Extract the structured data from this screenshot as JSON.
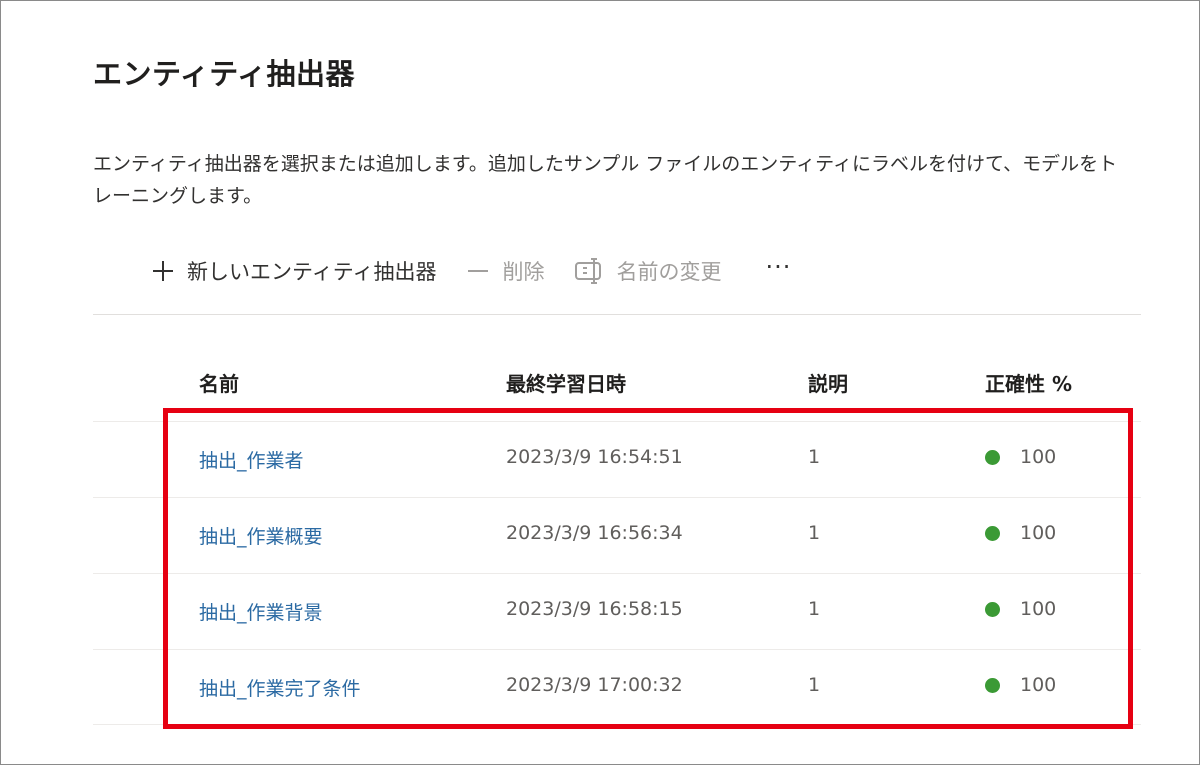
{
  "page": {
    "title": "エンティティ抽出器",
    "description": "エンティティ抽出器を選択または追加します。追加したサンプル ファイルのエンティティにラベルを付けて、モデルをトレーニングします。"
  },
  "toolbar": {
    "new_label": "新しいエンティティ抽出器",
    "delete_label": "削除",
    "rename_label": "名前の変更",
    "more_label": "···"
  },
  "table": {
    "columns": [
      "名前",
      "最終学習日時",
      "説明",
      "正確性 %"
    ],
    "rows": [
      {
        "name": "抽出_作業者",
        "date": "2023/3/9 16:54:51",
        "desc": "1",
        "accuracy": "100"
      },
      {
        "name": "抽出_作業概要",
        "date": "2023/3/9 16:56:34",
        "desc": "1",
        "accuracy": "100"
      },
      {
        "name": "抽出_作業背景",
        "date": "2023/3/9 16:58:15",
        "desc": "1",
        "accuracy": "100"
      },
      {
        "name": "抽出_作業完了条件",
        "date": "2023/3/9 17:00:32",
        "desc": "1",
        "accuracy": "100"
      }
    ]
  },
  "colors": {
    "link": "#2b6aa3",
    "status_ok": "#3b9a35",
    "highlight": "#e60012"
  },
  "icons": {
    "new": "plus-icon",
    "delete": "minus-icon",
    "rename": "rename-icon",
    "more": "more-icon",
    "status": "status-dot-icon"
  }
}
